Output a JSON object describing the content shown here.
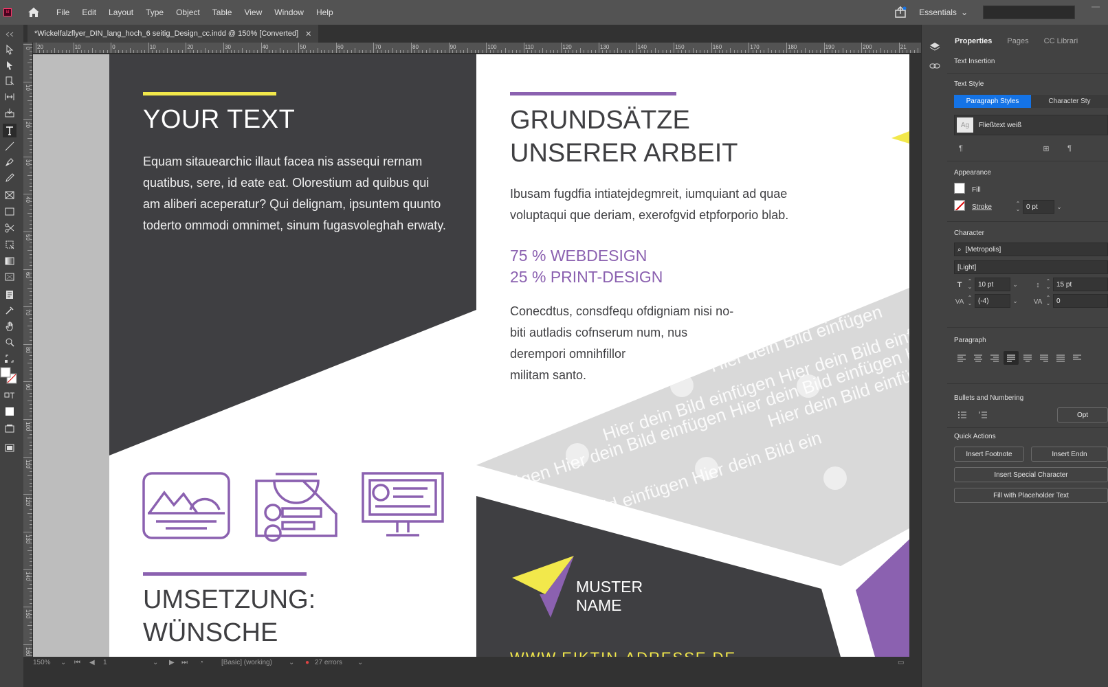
{
  "app": {
    "logo": "Id",
    "menu": [
      "File",
      "Edit",
      "Layout",
      "Type",
      "Object",
      "Table",
      "View",
      "Window",
      "Help"
    ],
    "workspace": "Essentials"
  },
  "document": {
    "tab_title": "*Wickelfalzflyer_DIN_lang_hoch_6 seitig_Design_cc.indd @ 150% [Converted]"
  },
  "ruler": {
    "h_labels": [
      "20",
      "10",
      "0",
      "10",
      "20",
      "30",
      "40",
      "50",
      "60",
      "70",
      "80",
      "90",
      "100",
      "110",
      "120",
      "130",
      "140",
      "150",
      "160",
      "170",
      "180",
      "190",
      "200",
      "21"
    ],
    "v_labels": [
      "0",
      "10",
      "20",
      "30",
      "40",
      "50",
      "60",
      "70",
      "80",
      "90",
      "100",
      "110",
      "120",
      "130",
      "140",
      "150",
      "160",
      "170"
    ]
  },
  "flyer": {
    "left": {
      "heading": "YOUR TEXT",
      "body": [
        "Equam sitauearchic illaut facea nis assequi rernam",
        "quatibus, sere, id eate eat. Olorestium ad quibus qui",
        "am aliberi aceperatur? Qui delignam, ipsuntem quunto",
        "toderto ommodi omnimet, sinum fugasvoleghah erwaty."
      ],
      "heading2": [
        "UMSETZUNG:",
        "WÜNSCHE"
      ]
    },
    "right": {
      "heading": [
        "GRUNDSÄTZE",
        "UNSERER ARBEIT"
      ],
      "intro": [
        "Ibusam fugdfia intiatejdegmreit, iumquiant ad quae",
        "voluptaqui que deriam, exerofgvid etpforporio blab."
      ],
      "stats": [
        "75 % WEBDESIGN",
        "25 % PRINT-DESIGN"
      ],
      "body": [
        "Conecdtus, consdfequ ofdigniam nisi no-",
        "biti autladis cofnserum num, nus",
        "derempori omnihfillor",
        "militam santo."
      ],
      "placeholder_text": "Hier dein Bild einfügen",
      "watermark_lines": [
        "Hier dein Bild einfügen",
        "Hier dein Bild einfügen Hier dein",
        "Hier dein Bild einfügen Hier dein Bild einfügen",
        "fügen Hier dein Bild einfügen Hier dein Bild einfügen Hier d",
        "ild einfügen Hier dein Bild einfügen Hier dein Bild einfügen",
        "ein Bild einfügen Hier dein Bild ein",
        "Hier dein Bild einfügen"
      ],
      "brand_name": [
        "MUSTER",
        "NAME"
      ],
      "url": "WWW.EIKTIN-ADRESSE.DE"
    }
  },
  "status": {
    "zoom": "150%",
    "page": "1",
    "profile": "[Basic] (working)",
    "errors": "27 errors"
  },
  "panel": {
    "tabs": [
      "Properties",
      "Pages",
      "CC Librari"
    ],
    "context": "Text Insertion",
    "text_style_title": "Text Style",
    "style_tabs": [
      "Paragraph Styles",
      "Character Sty"
    ],
    "current_style": "Fließtext weiß",
    "style_ag": "Ag",
    "appearance_title": "Appearance",
    "fill_label": "Fill",
    "stroke_label": "Stroke",
    "stroke_weight": "0 pt",
    "character_title": "Character",
    "font_family": "[Metropolis]",
    "font_style": "[Light]",
    "font_size": "10 pt",
    "leading": "15 pt",
    "kerning": "(-4)",
    "tracking": "0",
    "paragraph_title": "Paragraph",
    "bullets_title": "Bullets and Numbering",
    "bullets_options": "Opt",
    "quick_actions_title": "Quick Actions",
    "insert_footnote": "Insert Footnote",
    "insert_endnote": "Insert Endn",
    "insert_special": "Insert Special Character",
    "fill_placeholder": "Fill with Placeholder Text"
  },
  "colors": {
    "accent_blue": "#1473e6",
    "flyer_dark": "#3f3f42",
    "flyer_purple": "#8b61b0",
    "flyer_yellow": "#f2e84b",
    "placeholder_gray": "#d9d9d9"
  }
}
